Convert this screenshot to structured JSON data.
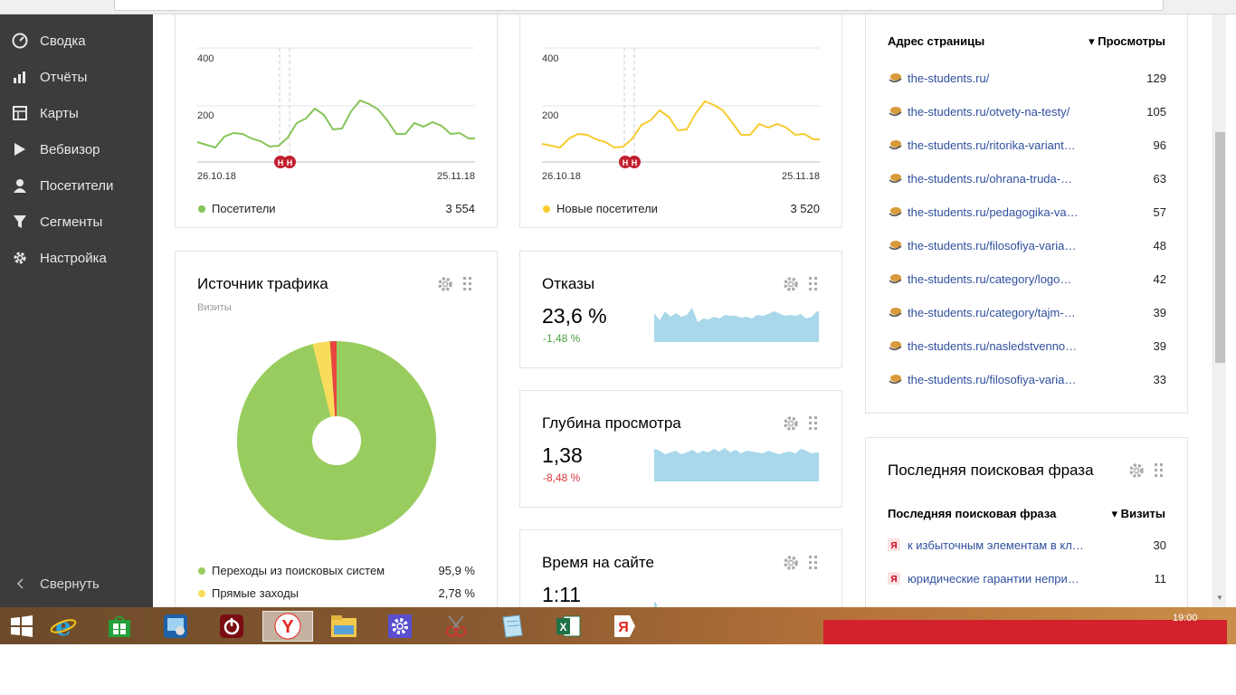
{
  "sidebar": {
    "items": [
      {
        "label": "Сводка",
        "icon": "dashboard-icon"
      },
      {
        "label": "Отчёты",
        "icon": "bar-chart-icon"
      },
      {
        "label": "Карты",
        "icon": "map-icon"
      },
      {
        "label": "Вебвизор",
        "icon": "play-icon"
      },
      {
        "label": "Посетители",
        "icon": "user-icon"
      },
      {
        "label": "Сегменты",
        "icon": "filter-icon"
      },
      {
        "label": "Настройка",
        "icon": "gear-icon"
      }
    ],
    "collapse_label": "Свернуть"
  },
  "visitors_chart": {
    "y_ticks": [
      "400",
      "200"
    ],
    "x_start": "26.10.18",
    "x_end": "25.11.18",
    "legend_label": "Посетители",
    "legend_value": "3 554",
    "color": "#86c559",
    "marker_labels": [
      "Н",
      "Н"
    ]
  },
  "new_visitors_chart": {
    "y_ticks": [
      "400",
      "200"
    ],
    "x_start": "26.10.18",
    "x_end": "25.11.18",
    "legend_label": "Новые посетители",
    "legend_value": "3 520",
    "color": "#f6cc2f",
    "marker_labels": [
      "Н",
      "Н"
    ]
  },
  "traffic_source": {
    "title": "Источник трафика",
    "subtitle": "Визиты",
    "legend": [
      {
        "label": "Переходы из поисковых систем",
        "value": "95,9 %",
        "color": "#99cc5e"
      },
      {
        "label": "Прямые заходы",
        "value": "2,78 %",
        "color": "#f9dc5c"
      }
    ]
  },
  "bounces": {
    "title": "Отказы",
    "value": "23,6 %",
    "delta": "-1,48 %"
  },
  "depth": {
    "title": "Глубина просмотра",
    "value": "1,38",
    "delta": "-8,48 %"
  },
  "time_on_site": {
    "title": "Время на сайте",
    "value": "1:11"
  },
  "pages": {
    "col_page": "Адрес страницы",
    "col_views": "▾ Просмотры",
    "rows": [
      {
        "url": "the-students.ru/",
        "views": "129"
      },
      {
        "url": "the-students.ru/otvety-na-testy/",
        "views": "105"
      },
      {
        "url": "the-students.ru/ritorika-variant…",
        "views": "96"
      },
      {
        "url": "the-students.ru/ohrana-truda-…",
        "views": "63"
      },
      {
        "url": "the-students.ru/pedagogika-va…",
        "views": "57"
      },
      {
        "url": "the-students.ru/filosofiya-varia…",
        "views": "48"
      },
      {
        "url": "the-students.ru/category/logo…",
        "views": "42"
      },
      {
        "url": "the-students.ru/category/tajm-…",
        "views": "39"
      },
      {
        "url": "the-students.ru/nasledstvenno…",
        "views": "39"
      },
      {
        "url": "the-students.ru/filosofiya-varia…",
        "views": "33"
      }
    ]
  },
  "search_phrase": {
    "title": "Последняя поисковая фраза",
    "col_phrase": "Последняя поисковая фраза",
    "col_visits": "▾ Визиты",
    "rows": [
      {
        "phrase": "к избыточным элементам в кл…",
        "visits": "30"
      },
      {
        "phrase": "юридические гарантии непри…",
        "visits": "11"
      }
    ]
  },
  "taskbar": {
    "clock": "19:00",
    "apps": [
      "windows-start-icon",
      "internet-explorer-icon",
      "windows-store-icon",
      "control-panel-icon",
      "power-icon",
      "yandex-browser-icon",
      "file-explorer-icon",
      "settings-icon",
      "snipping-tool-icon",
      "notepad-icon",
      "excel-icon",
      "yandex-icon"
    ]
  }
}
